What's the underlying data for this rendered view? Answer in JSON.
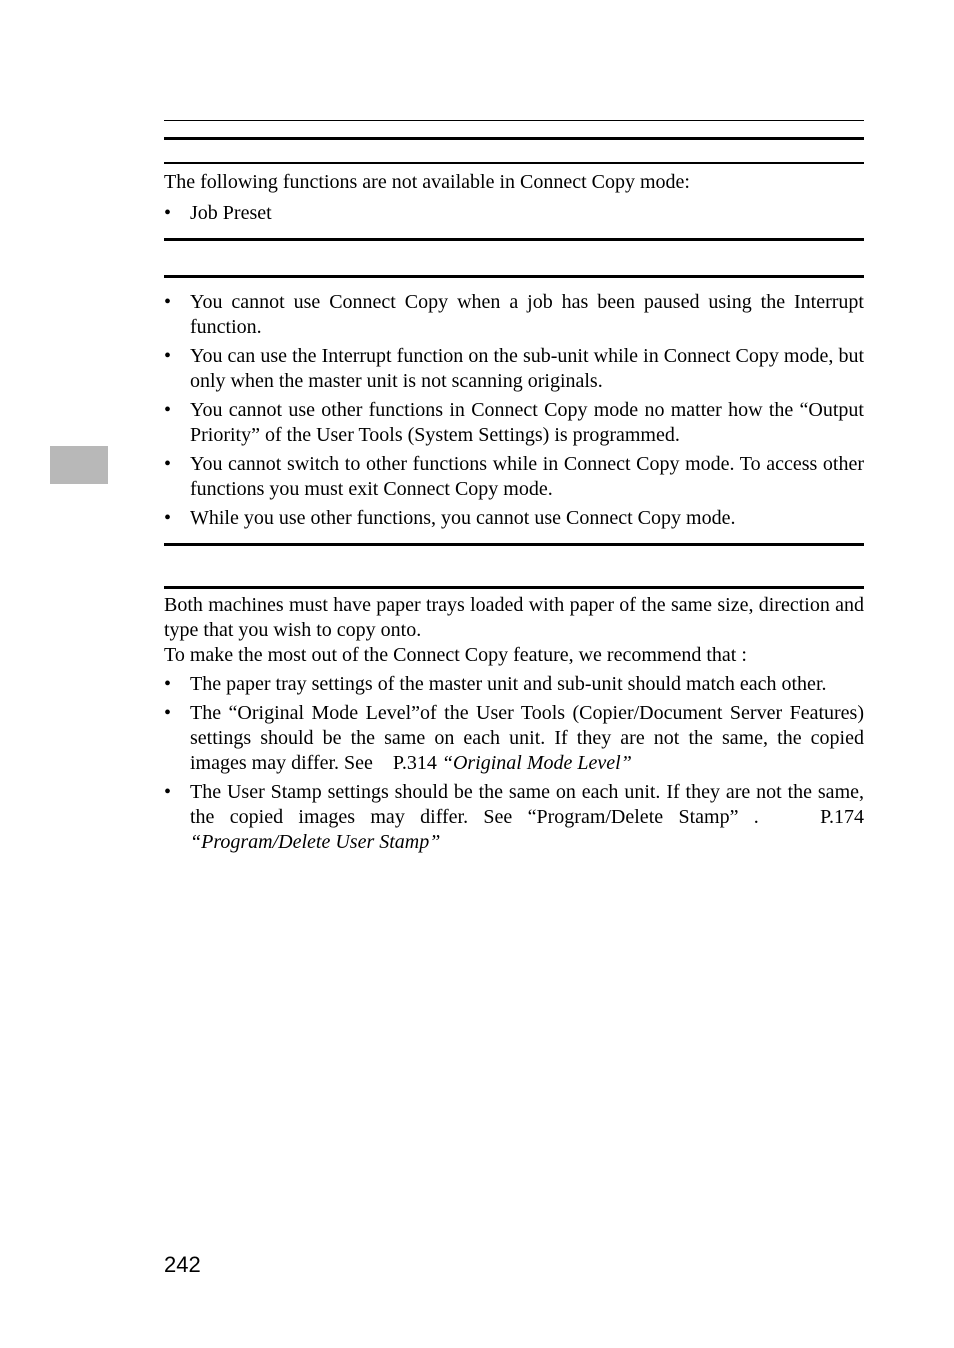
{
  "block1": {
    "lead": "The following functions are not available in Connect Copy mode:",
    "items": [
      "Job Preset"
    ]
  },
  "block2": {
    "items": [
      "You cannot use Connect Copy when a job has been paused using the Interrupt function.",
      "You can use the Interrupt function on the sub-unit while in Connect Copy mode, but only when the master unit is not scanning originals.",
      "You cannot use other functions in Connect Copy mode no matter how the “Output Priority” of the User Tools (System Settings) is programmed.",
      "You cannot switch to other functions while in Connect Copy mode. To access other functions you must exit Connect Copy mode.",
      "While you use other functions, you cannot use Connect Copy mode."
    ]
  },
  "block3": {
    "para1": "Both machines must have paper trays loaded with paper of the same size, direction and type that you wish to copy onto.",
    "para2": "To make the most out of the Connect Copy feature, we recommend that :",
    "item1": "The paper tray settings of the master unit and sub-unit should match each other.",
    "item2_pre": "The “Original Mode Level”of the User Tools (Copier/Document Server Features) settings should be the same on each unit. If they are not the same, the copied images may differ. See    P.314 ",
    "item2_ref": "“Original Mode Level”",
    "item3_pre": "The User Stamp settings should be the same on each unit. If they are not the same, the copied images may differ. See “Program/Delete Stamp” .    P.174 ",
    "item3_ref": "“Program/Delete User Stamp”"
  },
  "page_number": "242"
}
